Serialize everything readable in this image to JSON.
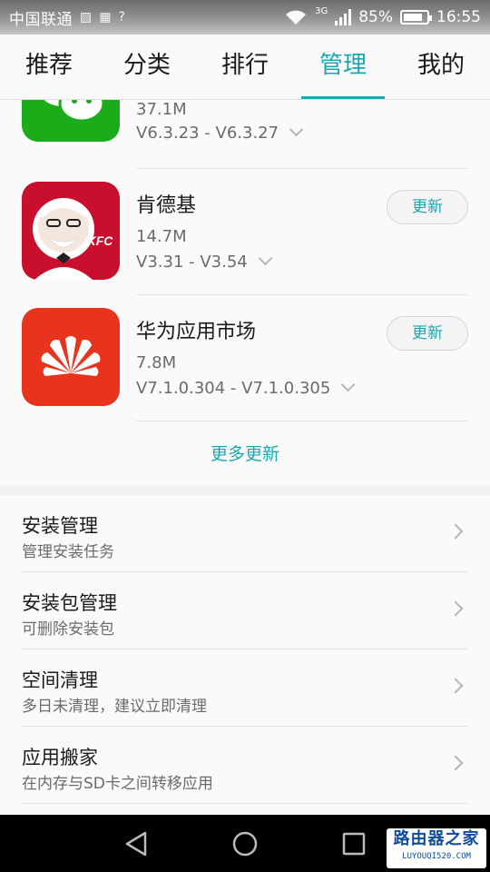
{
  "status_bar": {
    "carrier": "中国联通",
    "network": "3G",
    "battery": "85%",
    "battery_level": 0.85,
    "time": "16:55",
    "icons": [
      "image-icon",
      "keyboard-icon",
      "question-icon",
      "wifi-icon",
      "signal-icon",
      "battery-icon"
    ]
  },
  "tabs": [
    {
      "label": "推荐",
      "active": false
    },
    {
      "label": "分类",
      "active": false
    },
    {
      "label": "排行",
      "active": false
    },
    {
      "label": "管理",
      "active": true
    },
    {
      "label": "我的",
      "active": false
    }
  ],
  "updates": {
    "apps": [
      {
        "name": "",
        "size": "37.1M",
        "version": "V6.3.23 - V6.3.27",
        "icon": "wechat-icon",
        "button": ""
      },
      {
        "name": "肯德基",
        "size": "14.7M",
        "version": "V3.31 - V3.54",
        "icon": "kfc-icon",
        "icon_text": "KFC",
        "button": "更新"
      },
      {
        "name": "华为应用市场",
        "size": "7.8M",
        "version": "V7.1.0.304 - V7.1.0.305",
        "icon": "huawei-icon",
        "button": "更新"
      }
    ],
    "more_label": "更多更新"
  },
  "menu": [
    {
      "title": "安装管理",
      "subtitle": "管理安装任务"
    },
    {
      "title": "安装包管理",
      "subtitle": "可删除安装包"
    },
    {
      "title": "空间清理",
      "subtitle": "多日未清理，建议立即清理"
    },
    {
      "title": "应用搬家",
      "subtitle": "在内存与SD卡之间转移应用"
    }
  ],
  "watermark": {
    "main": "路由器之家",
    "sub": "LUYOUQI520.COM"
  },
  "colors": {
    "accent": "#1aa7b0",
    "wechat_green": "#1aad19",
    "kfc_red": "#c8102e",
    "huawei_red": "#e8341c"
  }
}
